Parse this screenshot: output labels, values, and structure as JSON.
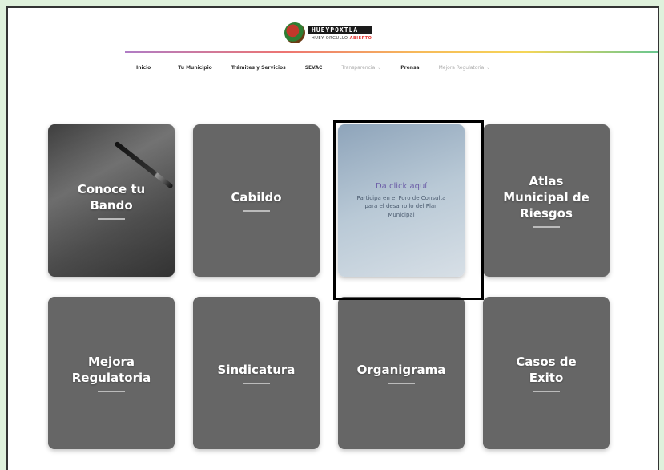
{
  "header": {
    "logo_name": "HUEYPOXTLA",
    "logo_tagline_prefix": "HUEY ORGULLO",
    "logo_tagline_highlight": "ABIERTO"
  },
  "nav": {
    "items": [
      {
        "label": "Inicio",
        "style": "bold"
      },
      {
        "label": "Tu Municipio",
        "style": "bold"
      },
      {
        "label": "Trámites y Servicios",
        "style": "bold"
      },
      {
        "label": "SEVAC",
        "style": "bold"
      },
      {
        "label": "Transparencia",
        "style": "light",
        "has_dropdown": true
      },
      {
        "label": "Prensa",
        "style": "bold"
      },
      {
        "label": "Mejora Regulatoria",
        "style": "light",
        "has_dropdown": true
      }
    ],
    "dropdown_icon": "chevron-down-icon"
  },
  "cards": [
    {
      "title": "Conoce tu Bando"
    },
    {
      "title": "Cabildo"
    },
    {
      "cta": "Da click aquí",
      "description": "Participa en el Foro de Consulta para el desarrollo del Plan Municipal"
    },
    {
      "title": "Atlas Municipal de Riesgos"
    },
    {
      "title": "Mejora Regulatoria"
    },
    {
      "title": "Sindicatura"
    },
    {
      "title": "Organigrama"
    },
    {
      "title": "Casos de Exito"
    }
  ],
  "colors": {
    "card_bg": "#666666",
    "consulta_bg": "#b9c9d6",
    "cta_color": "#6d5fa8",
    "page_bg": "#dff1dc"
  }
}
